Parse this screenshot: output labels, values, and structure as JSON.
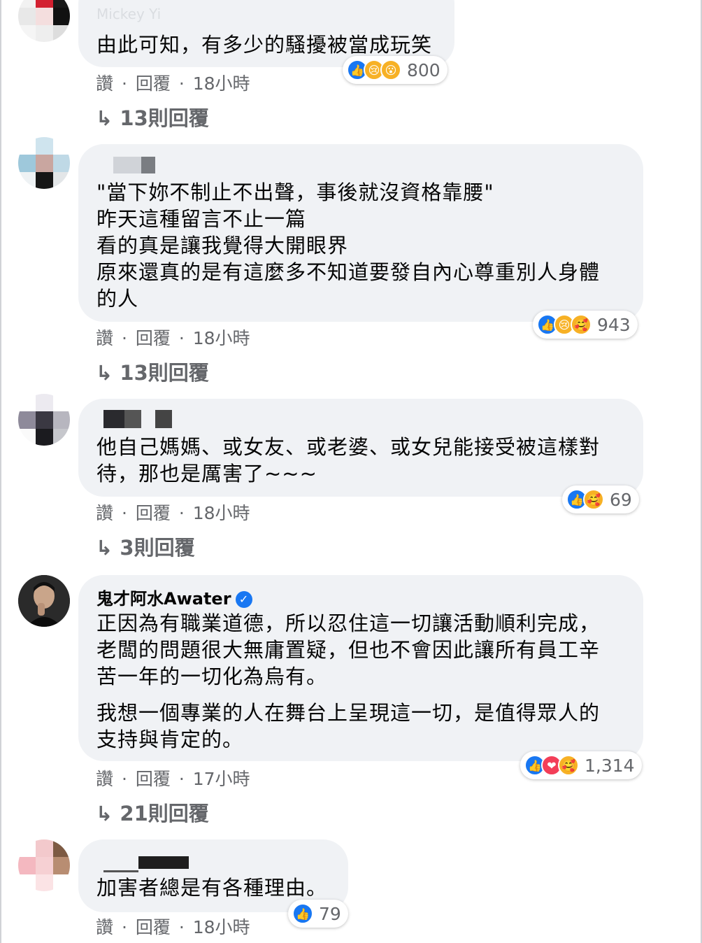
{
  "comments": [
    {
      "author": "Mickey Yi",
      "lines": "由此可知，有多少的騷擾被當成玩笑",
      "reactions": [
        "like",
        "sad",
        "wow"
      ],
      "count": "800",
      "like_label": "讚",
      "reply_label": "回覆",
      "time": "18小時",
      "replies": "↳ 13則回覆"
    },
    {
      "author": "",
      "lines": "\"當下妳不制止不出聲，事後就沒資格靠腰\"\n昨天這種留言不止一篇\n看的真是讓我覺得大開眼界\n原來還真的是有這麼多不知道要發自內心尊重別人身體\n的人",
      "reactions": [
        "like",
        "sad",
        "care"
      ],
      "count": "943",
      "like_label": "讚",
      "reply_label": "回覆",
      "time": "18小時",
      "replies": "↳ 13則回覆"
    },
    {
      "author": "",
      "lines": "他自己媽媽、或女友、或老婆、或女兒能接受被這樣對\n待，那也是厲害了~~~",
      "reactions": [
        "like",
        "care"
      ],
      "count": "69",
      "like_label": "讚",
      "reply_label": "回覆",
      "time": "18小時",
      "replies": "↳ 3則回覆"
    },
    {
      "author": "鬼才阿水Awater",
      "lines": "正因為有職業道德，所以忍住這一切讓活動順利完成，\n老闆的問題很大無庸置疑，但也不會因此讓所有員工辛\n苦一年的一切化為烏有。",
      "lines2": "我想一個專業的人在舞台上呈現這一切，是值得眾人的\n支持與肯定的。",
      "reactions": [
        "like",
        "love",
        "care"
      ],
      "count": "1,314",
      "like_label": "讚",
      "reply_label": "回覆",
      "time": "17小時",
      "replies": "↳ 21則回覆"
    },
    {
      "author": "",
      "lines": "加害者總是有各種理由。",
      "reactions": [
        "like"
      ],
      "count": "79",
      "like_label": "讚",
      "reply_label": "回覆",
      "time": "18小時"
    }
  ],
  "separator": "·"
}
